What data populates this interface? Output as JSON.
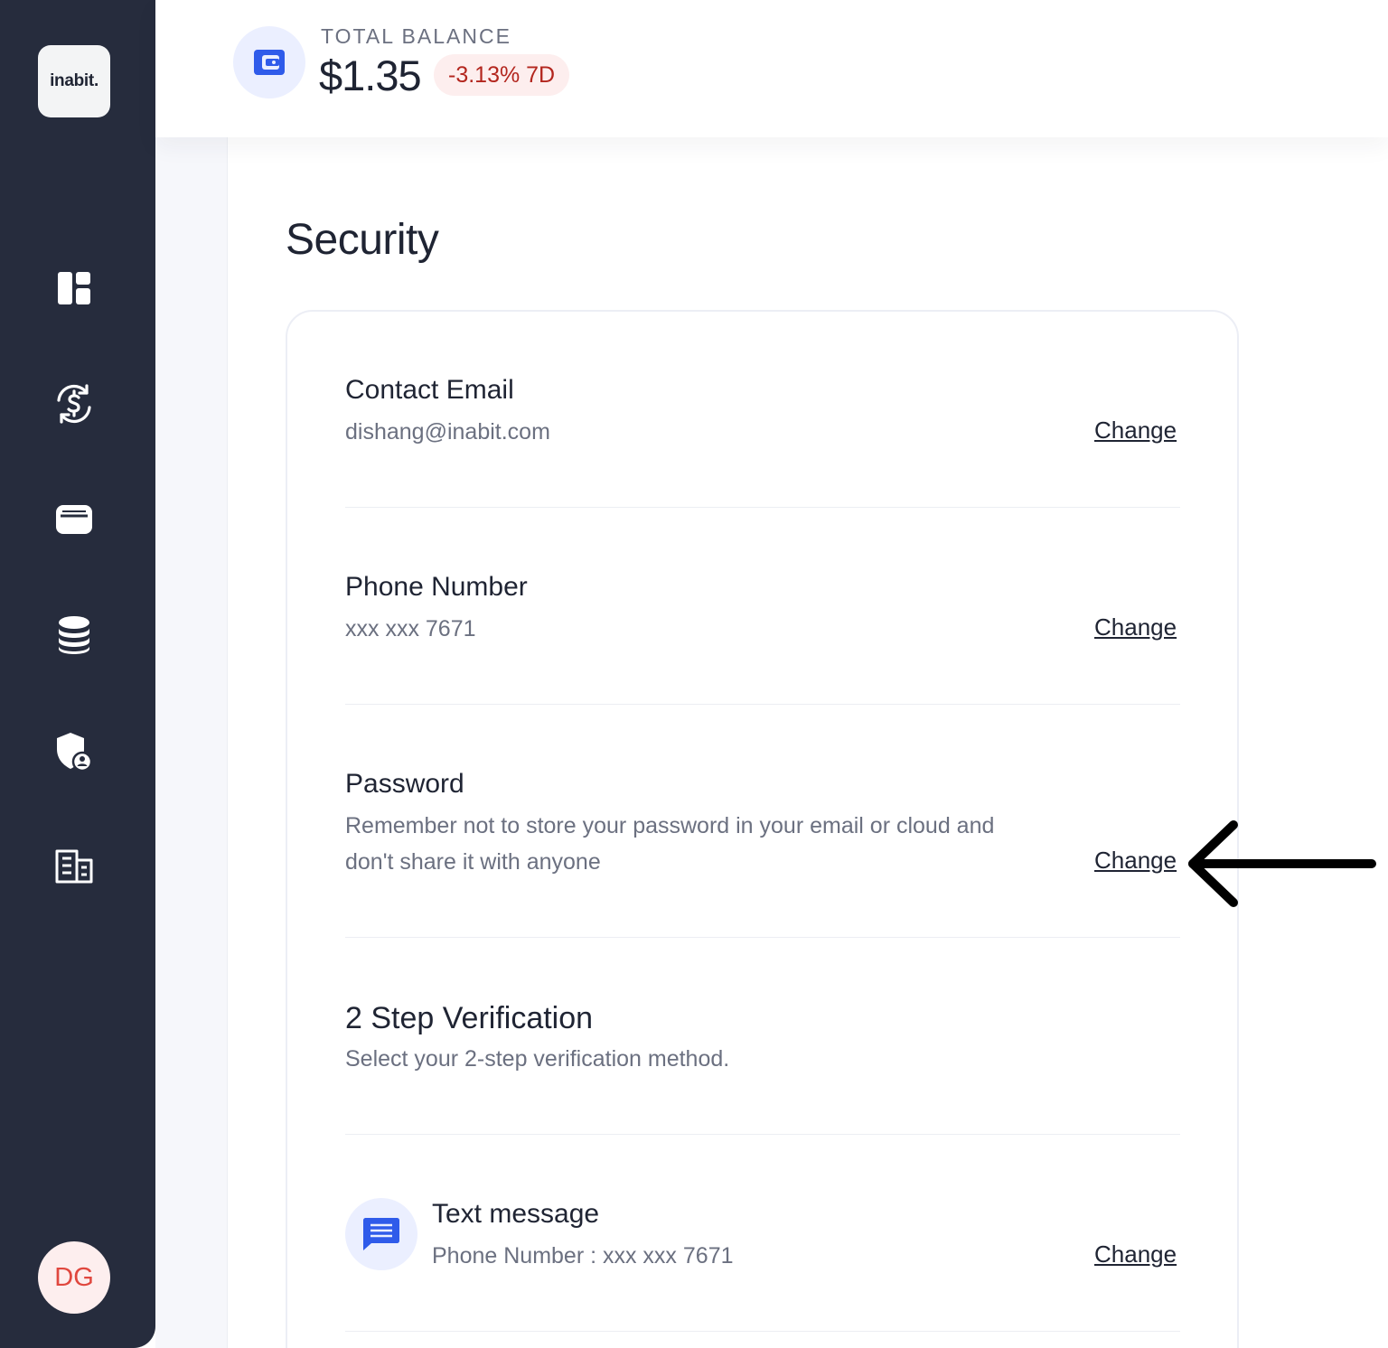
{
  "sidebar": {
    "logo_text": "inabit.",
    "nav": [
      {
        "icon": "dashboard-icon"
      },
      {
        "icon": "exchange-dollar-icon"
      },
      {
        "icon": "wallet-icon"
      },
      {
        "icon": "database-stack-icon"
      },
      {
        "icon": "shield-user-icon"
      },
      {
        "icon": "building-icon"
      }
    ],
    "avatar_initials": "DG"
  },
  "header": {
    "balance_label": "TOTAL BALANCE",
    "balance_value": "$1.35",
    "change_badge": "-3.13% 7D",
    "wallet_icon": "wallet-icon"
  },
  "page": {
    "title": "Security"
  },
  "security": {
    "contact_email": {
      "title": "Contact Email",
      "value": "dishang@inabit.com",
      "action": "Change"
    },
    "phone_number": {
      "title": "Phone Number",
      "value": "xxx xxx 7671",
      "action": "Change"
    },
    "password": {
      "title": "Password",
      "description_line1": "Remember not to store your password in your email or cloud and",
      "description_line2": "don't share it with anyone",
      "action": "Change"
    },
    "two_step": {
      "title": "2 Step Verification",
      "description": "Select your 2-step verification method."
    },
    "text_message": {
      "title": "Text message",
      "value": "Phone Number : xxx xxx 7671",
      "action": "Change",
      "icon": "message-icon"
    }
  },
  "colors": {
    "sidebar_bg": "#262c3d",
    "accent_blue": "#2f5bea",
    "negative_red": "#b3261e",
    "avatar_red": "#e0473e"
  }
}
